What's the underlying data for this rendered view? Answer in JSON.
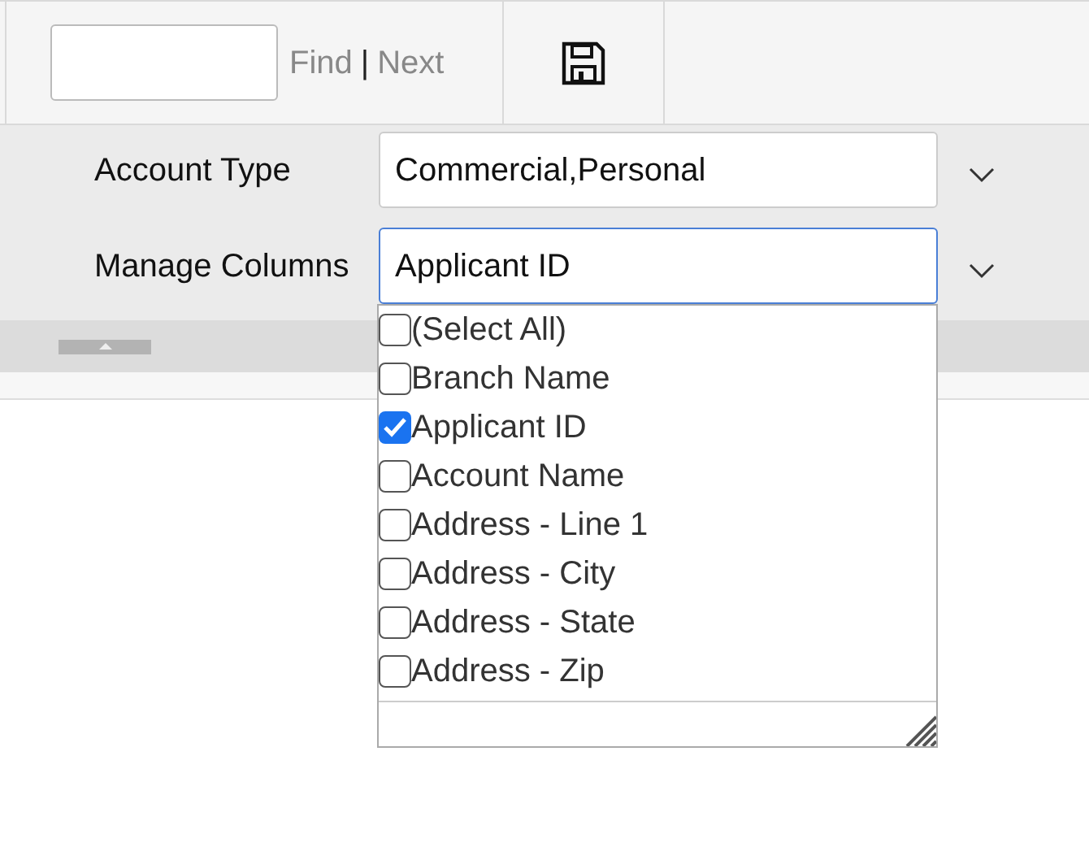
{
  "toolbar": {
    "find_link": "Find",
    "separator": "|",
    "next_link": "Next"
  },
  "filters": [
    {
      "label": "Account Type",
      "value": "Commercial,Personal",
      "focused": false
    },
    {
      "label": "Manage Columns",
      "value": "Applicant ID",
      "focused": true
    }
  ],
  "column_options": [
    {
      "label": "(Select All)",
      "checked": false
    },
    {
      "label": "Branch Name",
      "checked": false
    },
    {
      "label": "Applicant ID",
      "checked": true
    },
    {
      "label": "Account Name",
      "checked": false
    },
    {
      "label": "Address - Line 1",
      "checked": false
    },
    {
      "label": "Address - City",
      "checked": false
    },
    {
      "label": "Address - State",
      "checked": false
    },
    {
      "label": "Address - Zip",
      "checked": false
    }
  ]
}
